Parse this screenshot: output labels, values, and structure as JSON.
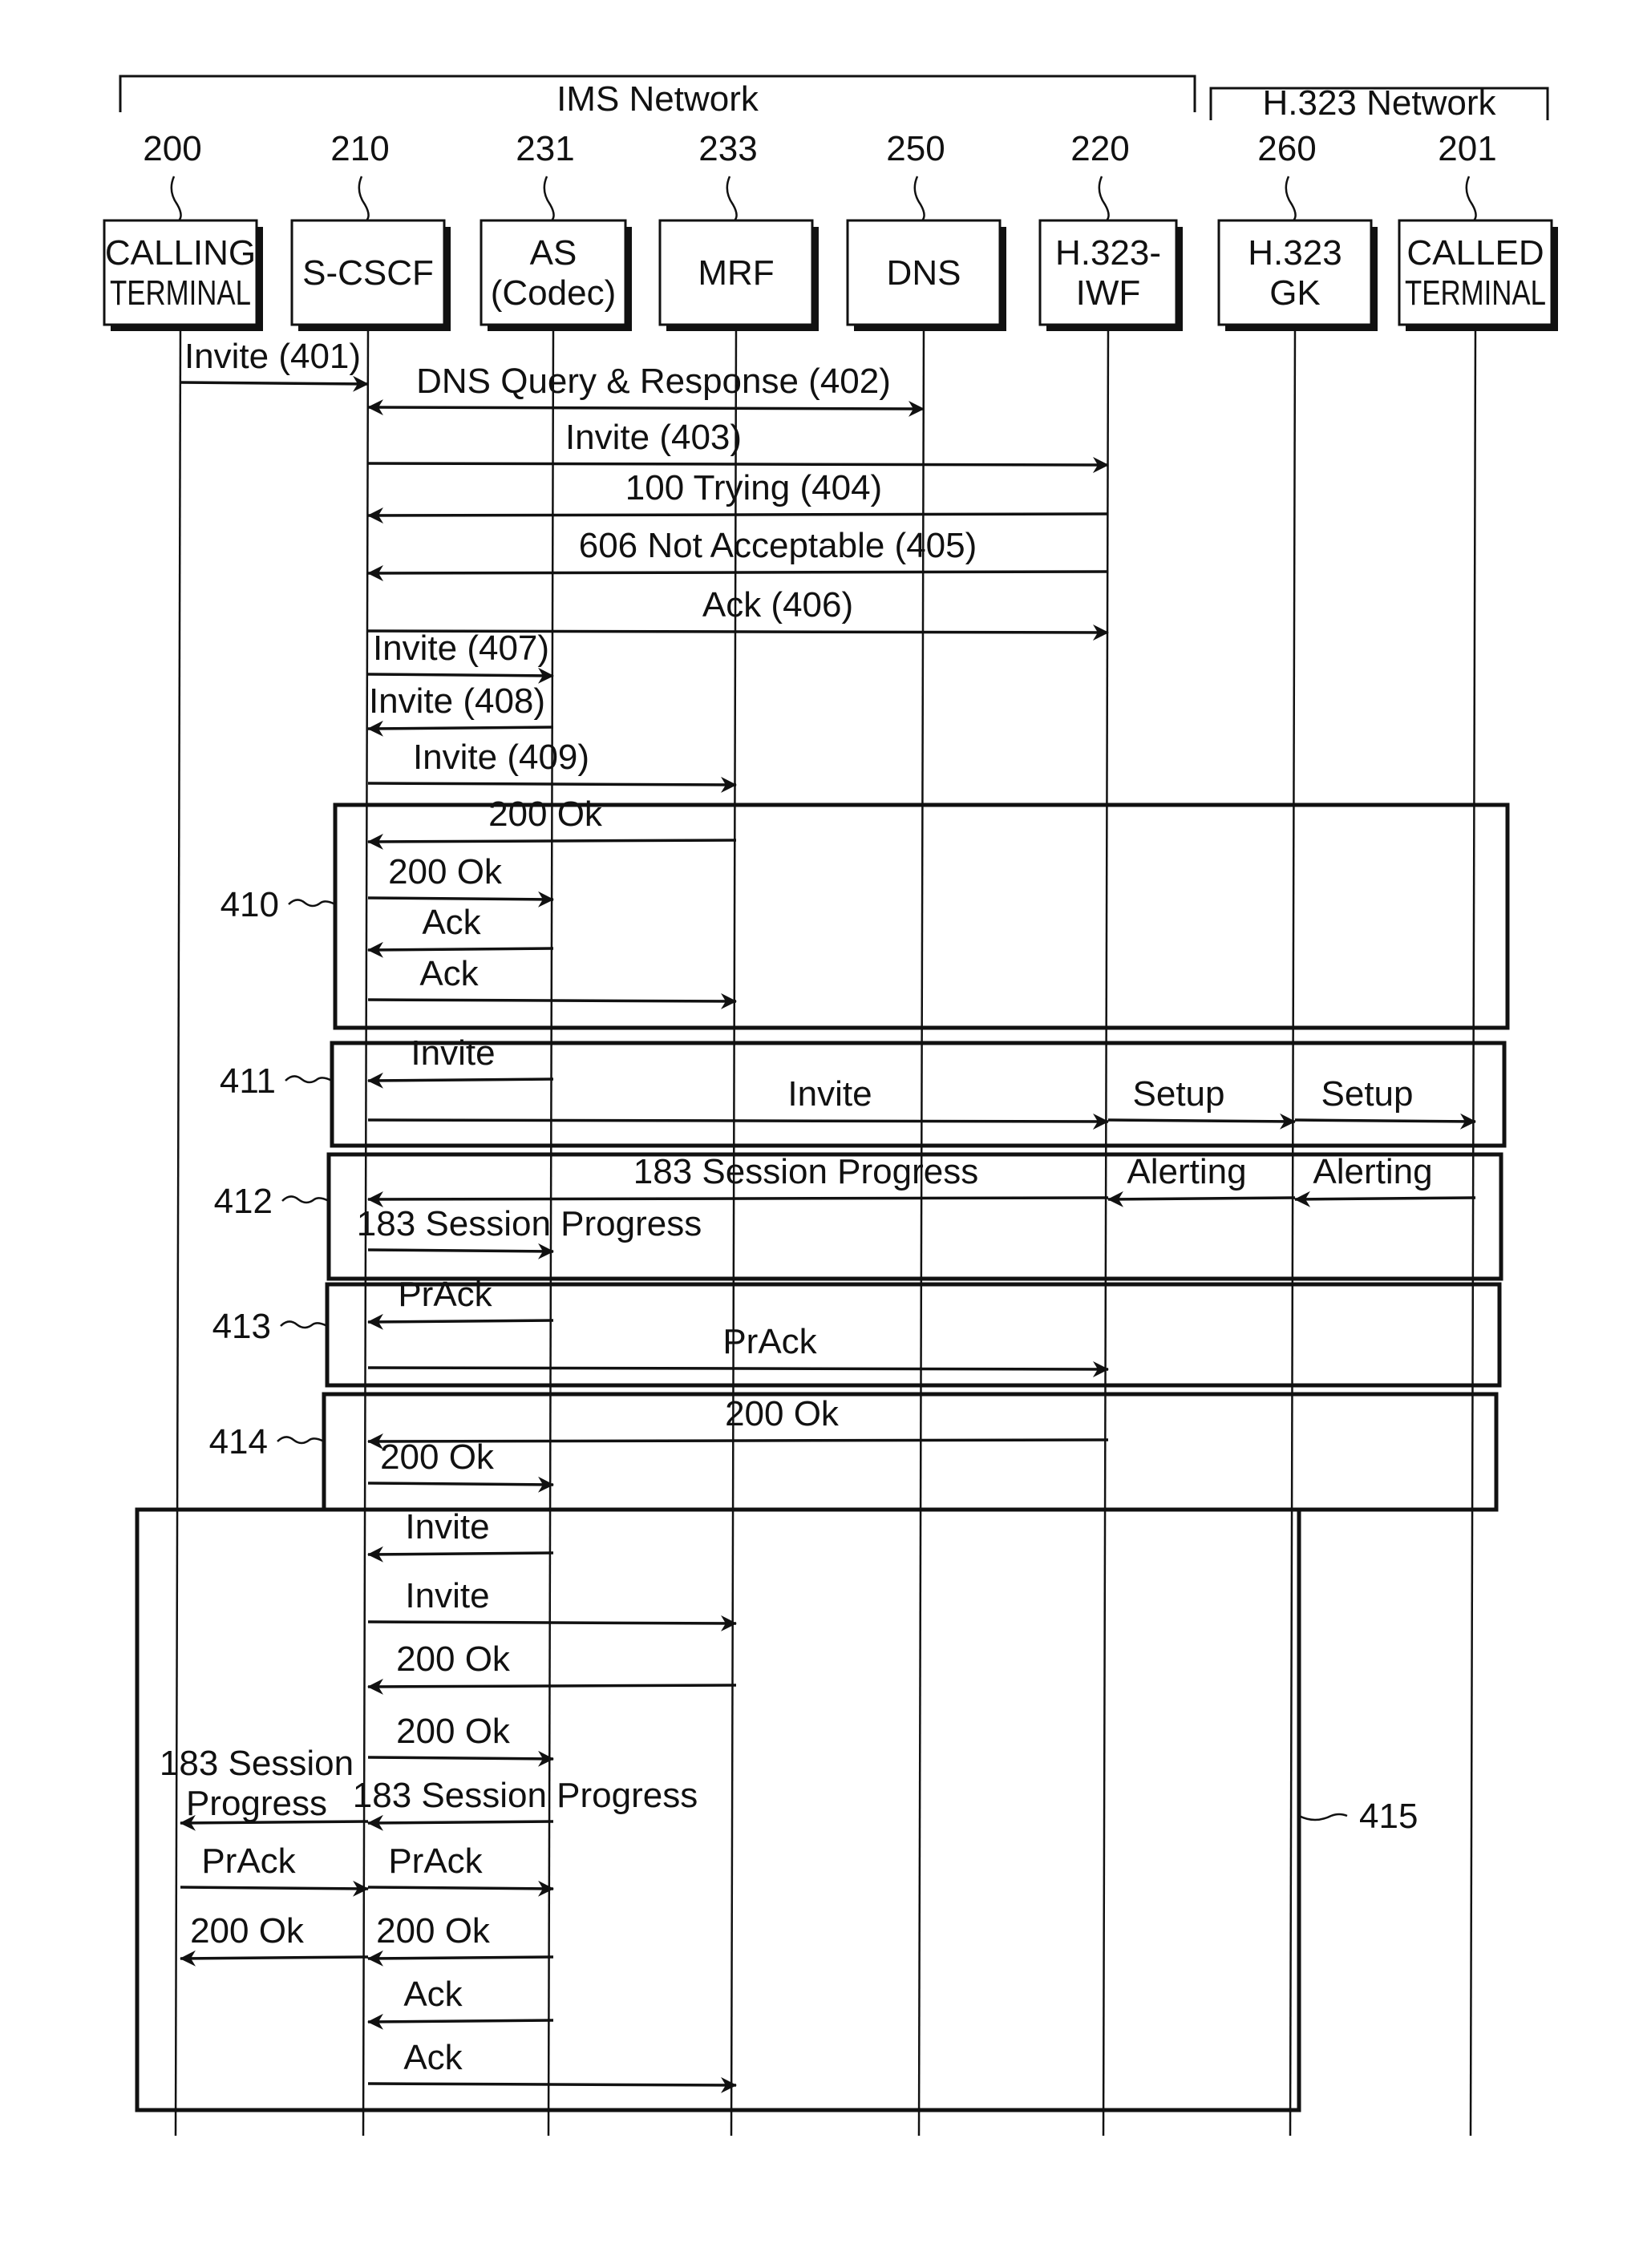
{
  "diagram": {
    "type": "sequence-diagram",
    "networks": [
      {
        "id": "ims",
        "label": "IMS Network",
        "spans": [
          "200",
          "220"
        ]
      },
      {
        "id": "h323",
        "label": "H.323 Network",
        "spans": [
          "260",
          "201"
        ]
      }
    ],
    "participants": [
      {
        "id": "200",
        "ref": "200",
        "lines": [
          "CALLING",
          "TERMINAL"
        ]
      },
      {
        "id": "210",
        "ref": "210",
        "lines": [
          "S-CSCF"
        ]
      },
      {
        "id": "231",
        "ref": "231",
        "lines": [
          "AS",
          "(Codec)"
        ]
      },
      {
        "id": "233",
        "ref": "233",
        "lines": [
          "MRF"
        ]
      },
      {
        "id": "250",
        "ref": "250",
        "lines": [
          "DNS"
        ]
      },
      {
        "id": "220",
        "ref": "220",
        "lines": [
          "H.323-",
          "IWF"
        ]
      },
      {
        "id": "260",
        "ref": "260",
        "lines": [
          "H.323",
          "GK"
        ]
      },
      {
        "id": "201",
        "ref": "201",
        "lines": [
          "CALLED",
          "TERMINAL"
        ]
      }
    ],
    "groups": [
      {
        "ref": "410",
        "label": "410"
      },
      {
        "ref": "411",
        "label": "411"
      },
      {
        "ref": "412",
        "label": "412"
      },
      {
        "ref": "413",
        "label": "413"
      },
      {
        "ref": "414",
        "label": "414"
      },
      {
        "ref": "415",
        "label": "415"
      }
    ],
    "messages": [
      {
        "from": "200",
        "to": "210",
        "label": "Invite (401)",
        "group": null
      },
      {
        "from": "210",
        "to": "250",
        "label": "DNS Query & Response (402)",
        "bidirectional": true,
        "group": null
      },
      {
        "from": "210",
        "to": "220",
        "label": "Invite (403)",
        "group": null
      },
      {
        "from": "220",
        "to": "210",
        "label": "100 Trying (404)",
        "group": null
      },
      {
        "from": "220",
        "to": "210",
        "label": "606 Not Acceptable (405)",
        "group": null
      },
      {
        "from": "210",
        "to": "220",
        "label": "Ack (406)",
        "group": null
      },
      {
        "from": "210",
        "to": "231",
        "label": "Invite (407)",
        "group": null
      },
      {
        "from": "231",
        "to": "210",
        "label": "Invite (408)",
        "group": null
      },
      {
        "from": "210",
        "to": "233",
        "label": "Invite (409)",
        "group": null
      },
      {
        "from": "233",
        "to": "210",
        "label": "200 Ok",
        "group": "410"
      },
      {
        "from": "210",
        "to": "231",
        "label": "200 Ok",
        "group": "410"
      },
      {
        "from": "231",
        "to": "210",
        "label": "Ack",
        "group": "410"
      },
      {
        "from": "210",
        "to": "233",
        "label": "Ack",
        "group": "410"
      },
      {
        "from": "231",
        "to": "210",
        "label": "Invite",
        "group": "411"
      },
      {
        "from": "210",
        "to": "220",
        "label": "Invite",
        "group": "411"
      },
      {
        "from": "220",
        "to": "260",
        "label": "Setup",
        "group": "411"
      },
      {
        "from": "260",
        "to": "201",
        "label": "Setup",
        "group": "411"
      },
      {
        "from": "201",
        "to": "260",
        "label": "Alerting",
        "group": "412"
      },
      {
        "from": "260",
        "to": "220",
        "label": "Alerting",
        "group": "412"
      },
      {
        "from": "220",
        "to": "210",
        "label": "183 Session Progress",
        "group": "412"
      },
      {
        "from": "210",
        "to": "231",
        "label": "183 Session Progress",
        "group": "412"
      },
      {
        "from": "231",
        "to": "210",
        "label": "PrAck",
        "group": "413"
      },
      {
        "from": "210",
        "to": "220",
        "label": "PrAck",
        "group": "413"
      },
      {
        "from": "220",
        "to": "210",
        "label": "200 Ok",
        "group": "414"
      },
      {
        "from": "210",
        "to": "231",
        "label": "200 Ok",
        "group": "414"
      },
      {
        "from": "231",
        "to": "210",
        "label": "Invite",
        "group": "415"
      },
      {
        "from": "210",
        "to": "233",
        "label": "Invite",
        "group": "415"
      },
      {
        "from": "233",
        "to": "210",
        "label": "200 Ok",
        "group": "415"
      },
      {
        "from": "210",
        "to": "231",
        "label": "200 Ok",
        "group": "415"
      },
      {
        "from": "231",
        "to": "210",
        "label": "183 Session Progress",
        "group": "415"
      },
      {
        "from": "210",
        "to": "200",
        "label": "183 Session Progress",
        "group": "415"
      },
      {
        "from": "200",
        "to": "210",
        "label": "PrAck",
        "group": "415"
      },
      {
        "from": "210",
        "to": "231",
        "label": "PrAck",
        "group": "415"
      },
      {
        "from": "231",
        "to": "210",
        "label": "200 Ok",
        "group": "415"
      },
      {
        "from": "210",
        "to": "200",
        "label": "200 Ok",
        "group": "415"
      },
      {
        "from": "231",
        "to": "210",
        "label": "Ack",
        "group": "415"
      },
      {
        "from": "210",
        "to": "233",
        "label": "Ack",
        "group": "415"
      }
    ]
  }
}
